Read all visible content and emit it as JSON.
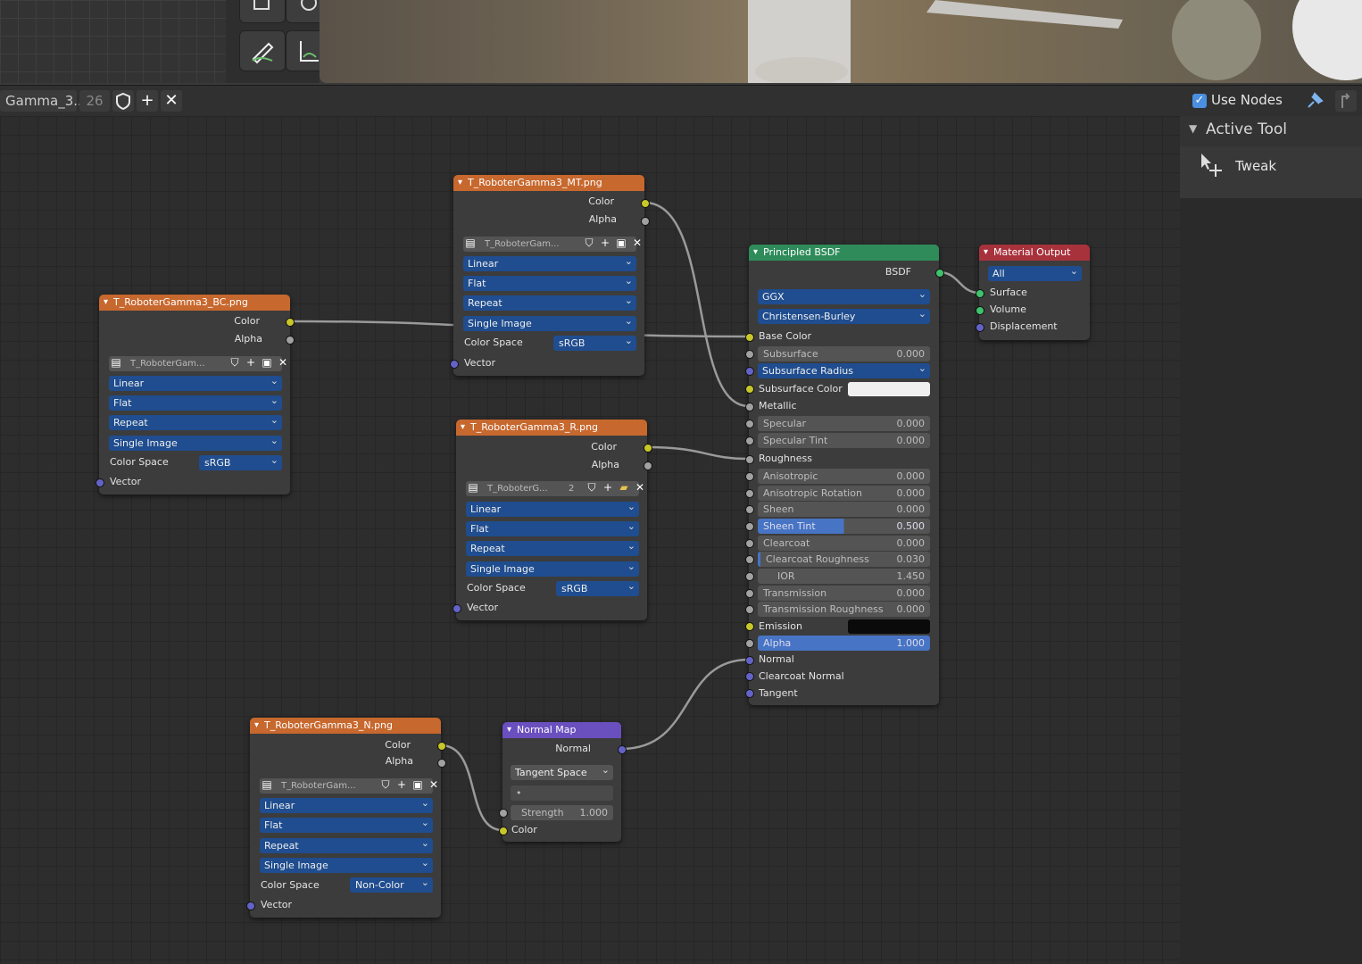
{
  "header": {
    "material_name": "Gamma_3...",
    "user_count": "26",
    "use_nodes_label": "Use Nodes",
    "use_nodes_checked": true
  },
  "sidebar": {
    "section_title": "Active Tool",
    "tool_name": "Tweak"
  },
  "nodes": {
    "mt": {
      "title": "T_RoboterGamma3_MT.png",
      "out_color": "Color",
      "out_alpha": "Alpha",
      "image_name": "T_RoboterGam...",
      "interpolation": "Linear",
      "projection": "Flat",
      "extension": "Repeat",
      "source": "Single Image",
      "color_space_label": "Color Space",
      "color_space": "sRGB",
      "in_vector": "Vector"
    },
    "bc": {
      "title": "T_RoboterGamma3_BC.png",
      "out_color": "Color",
      "out_alpha": "Alpha",
      "image_name": "T_RoboterGam...",
      "interpolation": "Linear",
      "projection": "Flat",
      "extension": "Repeat",
      "source": "Single Image",
      "color_space_label": "Color Space",
      "color_space": "sRGB",
      "in_vector": "Vector"
    },
    "r": {
      "title": "T_RoboterGamma3_R.png",
      "out_color": "Color",
      "out_alpha": "Alpha",
      "image_name": "T_RoboterG...",
      "image_users": "2",
      "interpolation": "Linear",
      "projection": "Flat",
      "extension": "Repeat",
      "source": "Single Image",
      "color_space_label": "Color Space",
      "color_space": "sRGB",
      "in_vector": "Vector"
    },
    "n": {
      "title": "T_RoboterGamma3_N.png",
      "out_color": "Color",
      "out_alpha": "Alpha",
      "image_name": "T_RoboterGam...",
      "interpolation": "Linear",
      "projection": "Flat",
      "extension": "Repeat",
      "source": "Single Image",
      "color_space_label": "Color Space",
      "color_space": "Non-Color",
      "in_vector": "Vector"
    },
    "normalmap": {
      "title": "Normal Map",
      "out_normal": "Normal",
      "space": "Tangent Space",
      "uv": "•",
      "strength_label": "Strength",
      "strength": "1.000",
      "in_color": "Color"
    },
    "bsdf": {
      "title": "Principled BSDF",
      "out_bsdf": "BSDF",
      "distribution": "GGX",
      "subsurface_method": "Christensen-Burley",
      "base_color": "Base Color",
      "subsurface": {
        "label": "Subsurface",
        "value": "0.000"
      },
      "subsurface_radius": "Subsurface Radius",
      "subsurface_color": "Subsurface Color",
      "metallic": "Metallic",
      "specular": {
        "label": "Specular",
        "value": "0.000"
      },
      "specular_tint": {
        "label": "Specular Tint",
        "value": "0.000"
      },
      "roughness": "Roughness",
      "anisotropic": {
        "label": "Anisotropic",
        "value": "0.000"
      },
      "anisotropic_rotation": {
        "label": "Anisotropic Rotation",
        "value": "0.000"
      },
      "sheen": {
        "label": "Sheen",
        "value": "0.000"
      },
      "sheen_tint": {
        "label": "Sheen Tint",
        "value": "0.500"
      },
      "clearcoat": {
        "label": "Clearcoat",
        "value": "0.000"
      },
      "clearcoat_roughness": {
        "label": "Clearcoat Roughness",
        "value": "0.030"
      },
      "ior": {
        "label": "IOR",
        "value": "1.450"
      },
      "transmission": {
        "label": "Transmission",
        "value": "0.000"
      },
      "transmission_roughness": {
        "label": "Transmission Roughness",
        "value": "0.000"
      },
      "emission": "Emission",
      "alpha": {
        "label": "Alpha",
        "value": "1.000"
      },
      "normal": "Normal",
      "clearcoat_normal": "Clearcoat Normal",
      "tangent": "Tangent"
    },
    "output": {
      "title": "Material Output",
      "target": "All",
      "surface": "Surface",
      "volume": "Volume",
      "displacement": "Displacement"
    }
  },
  "colors": {
    "image_header": "#c7682e",
    "shader_header": "#2f8c5a",
    "output_header": "#a8323c",
    "vector_header": "#6a4fbf",
    "link": "#9a9a9a"
  }
}
